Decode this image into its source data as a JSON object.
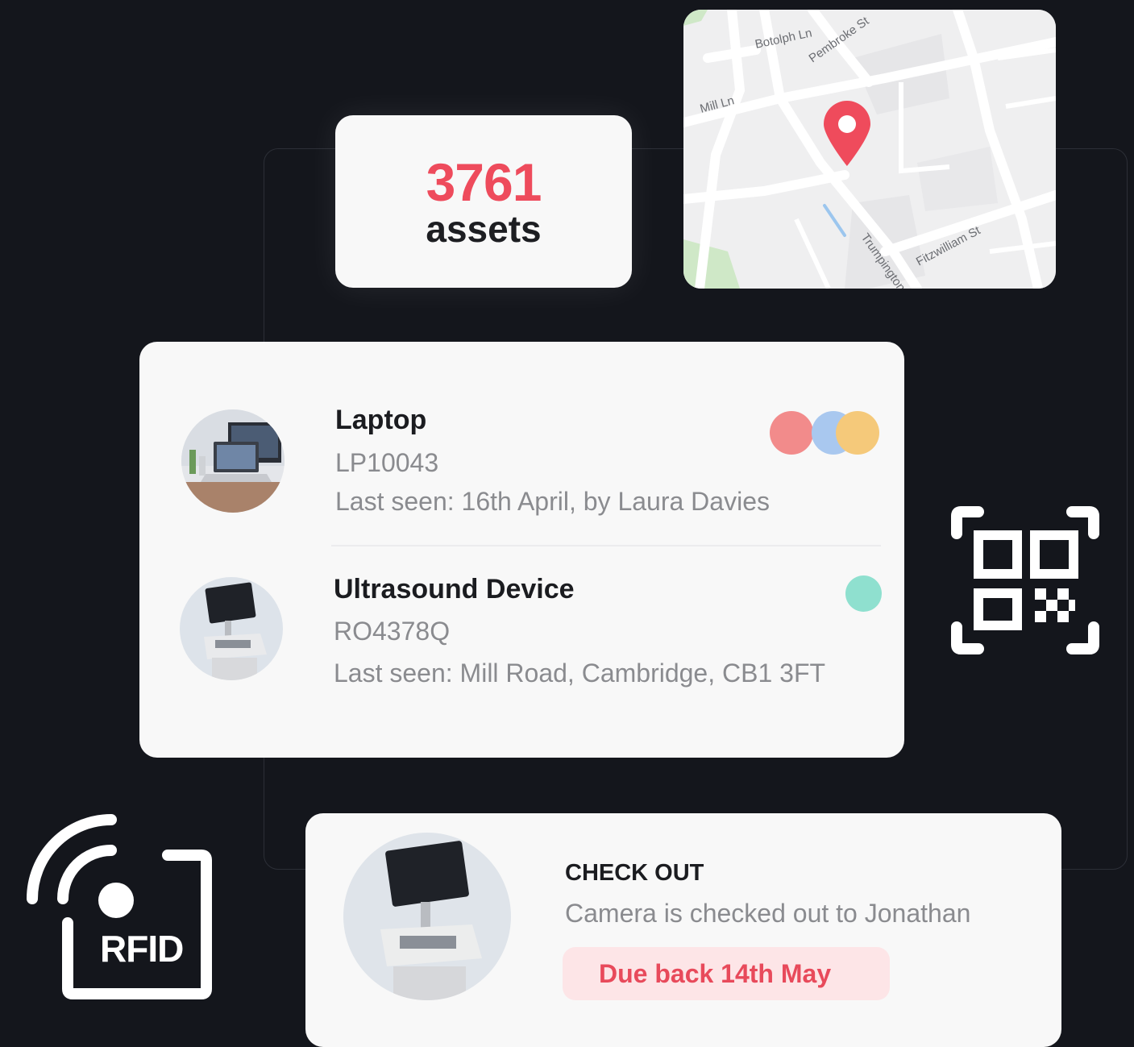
{
  "summary": {
    "count": "3761",
    "label": "assets"
  },
  "map": {
    "streets": [
      "Botolph Ln",
      "Pembroke St",
      "Mill Ln",
      "Trumpington St",
      "Fitzwilliam St"
    ],
    "pin_color": "#ef4b5c"
  },
  "assets": [
    {
      "name": "Laptop",
      "code": "LP10043",
      "last_seen": "Last seen: 16th April, by Laura Davies",
      "tag_colors": [
        "#f28b8b",
        "#a9c8ef",
        "#f5c97a"
      ]
    },
    {
      "name": "Ultrasound Device",
      "code": "RO4378Q",
      "last_seen": "Last seen: Mill Road, Cambridge, CB1 3FT",
      "tag_colors": [
        "#8fe0cf"
      ]
    }
  ],
  "checkout": {
    "title": "CHECK OUT",
    "text": "Camera is checked out to Jonathan",
    "due": "Due back 14th May"
  },
  "rfid": {
    "label": "RFID"
  },
  "colors": {
    "accent": "#ee4b5c",
    "background": "#14161c",
    "card": "#f8f8f8"
  }
}
